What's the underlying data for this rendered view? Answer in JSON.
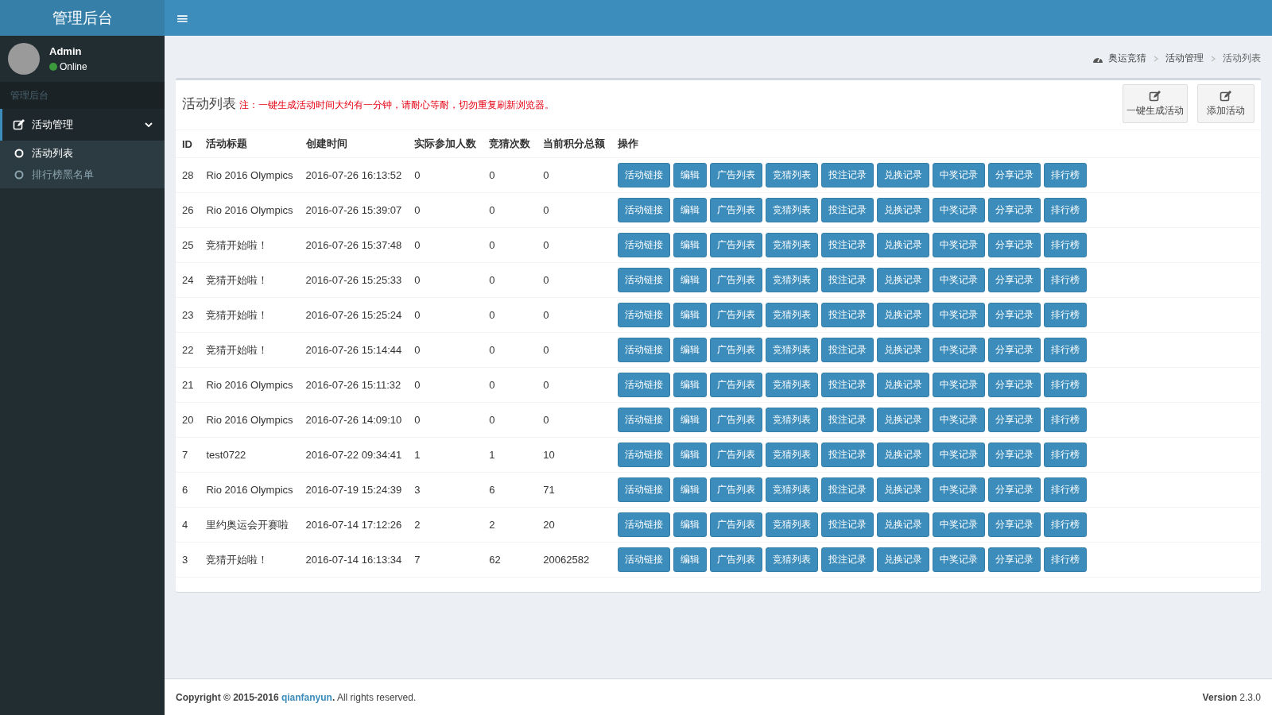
{
  "header": {
    "logo": "管理后台",
    "menu_toggle": "≡"
  },
  "sidebar": {
    "user": {
      "name": "Admin",
      "status": "Online",
      "online": true
    },
    "section_label": "管理后台",
    "items": [
      {
        "label": "活动管理",
        "expanded": true,
        "children": [
          {
            "label": "活动列表",
            "selected": true
          },
          {
            "label": "排行榜黑名单",
            "selected": false
          }
        ]
      }
    ]
  },
  "breadcrumb": [
    "奥运竞猜",
    "活动管理",
    "活动列表"
  ],
  "panel": {
    "title": "活动列表",
    "note": "注：一键生成活动时间大约有一分钟，请耐心等耐，切勿重复刷新浏览器。",
    "tools": [
      "一键生成活动",
      "添加活动"
    ]
  },
  "table": {
    "columns": [
      "ID",
      "活动标题",
      "创建时间",
      "实际参加人数",
      "竞猜次数",
      "当前积分总额",
      "操作"
    ],
    "rows": [
      {
        "cells": [
          "28",
          "Rio 2016 Olympics",
          "2016-07-26 16:13:52",
          "0",
          "0",
          "0"
        ],
        "actions": [
          "活动链接",
          "编辑",
          "广告列表",
          "竞猜列表",
          "投注记录",
          "兑换记录",
          "中奖记录",
          "分享记录",
          "排行榜"
        ]
      },
      {
        "cells": [
          "26",
          "Rio 2016 Olympics",
          "2016-07-26 15:39:07",
          "0",
          "0",
          "0"
        ],
        "actions": [
          "活动链接",
          "编辑",
          "广告列表",
          "竞猜列表",
          "投注记录",
          "兑换记录",
          "中奖记录",
          "分享记录",
          "排行榜"
        ]
      },
      {
        "cells": [
          "25",
          "竞猜开始啦！",
          "2016-07-26 15:37:48",
          "0",
          "0",
          "0"
        ],
        "actions": [
          "活动链接",
          "编辑",
          "广告列表",
          "竞猜列表",
          "投注记录",
          "兑换记录",
          "中奖记录",
          "分享记录",
          "排行榜"
        ]
      },
      {
        "cells": [
          "24",
          "竞猜开始啦！",
          "2016-07-26 15:25:33",
          "0",
          "0",
          "0"
        ],
        "actions": [
          "活动链接",
          "编辑",
          "广告列表",
          "竞猜列表",
          "投注记录",
          "兑换记录",
          "中奖记录",
          "分享记录",
          "排行榜"
        ]
      },
      {
        "cells": [
          "23",
          "竞猜开始啦！",
          "2016-07-26 15:25:24",
          "0",
          "0",
          "0"
        ],
        "actions": [
          "活动链接",
          "编辑",
          "广告列表",
          "竞猜列表",
          "投注记录",
          "兑换记录",
          "中奖记录",
          "分享记录",
          "排行榜"
        ]
      },
      {
        "cells": [
          "22",
          "竞猜开始啦！",
          "2016-07-26 15:14:44",
          "0",
          "0",
          "0"
        ],
        "actions": [
          "活动链接",
          "编辑",
          "广告列表",
          "竞猜列表",
          "投注记录",
          "兑换记录",
          "中奖记录",
          "分享记录",
          "排行榜"
        ]
      },
      {
        "cells": [
          "21",
          "Rio 2016 Olympics",
          "2016-07-26 15:11:32",
          "0",
          "0",
          "0"
        ],
        "actions": [
          "活动链接",
          "编辑",
          "广告列表",
          "竞猜列表",
          "投注记录",
          "兑换记录",
          "中奖记录",
          "分享记录",
          "排行榜"
        ]
      },
      {
        "cells": [
          "20",
          "Rio 2016 Olympics",
          "2016-07-26 14:09:10",
          "0",
          "0",
          "0"
        ],
        "actions": [
          "活动链接",
          "编辑",
          "广告列表",
          "竞猜列表",
          "投注记录",
          "兑换记录",
          "中奖记录",
          "分享记录",
          "排行榜"
        ]
      },
      {
        "cells": [
          "7",
          "test0722",
          "2016-07-22 09:34:41",
          "1",
          "1",
          "10"
        ],
        "actions": [
          "活动链接",
          "编辑",
          "广告列表",
          "竞猜列表",
          "投注记录",
          "兑换记录",
          "中奖记录",
          "分享记录",
          "排行榜"
        ]
      },
      {
        "cells": [
          "6",
          "Rio 2016 Olympics",
          "2016-07-19 15:24:39",
          "3",
          "6",
          "71"
        ],
        "actions": [
          "活动链接",
          "编辑",
          "广告列表",
          "竞猜列表",
          "投注记录",
          "兑换记录",
          "中奖记录",
          "分享记录",
          "排行榜"
        ]
      },
      {
        "cells": [
          "4",
          "里约奥运会开赛啦",
          "2016-07-14 17:12:26",
          "2",
          "2",
          "20"
        ],
        "actions": [
          "活动链接",
          "编辑",
          "广告列表",
          "竞猜列表",
          "投注记录",
          "兑换记录",
          "中奖记录",
          "分享记录",
          "排行榜"
        ]
      },
      {
        "cells": [
          "3",
          "竞猜开始啦！",
          "2016-07-14 16:13:34",
          "7",
          "62",
          "20062582"
        ],
        "actions": [
          "活动链接",
          "编辑",
          "广告列表",
          "竞猜列表",
          "投注记录",
          "兑换记录",
          "中奖记录",
          "分享记录",
          "排行榜"
        ]
      }
    ]
  },
  "footer": {
    "prefix": "Copyright © 2015-2016",
    "link": "qianfanyun",
    "suffix": "**.** All rights reserved.",
    "version": "**Version** 2.3.0"
  }
}
